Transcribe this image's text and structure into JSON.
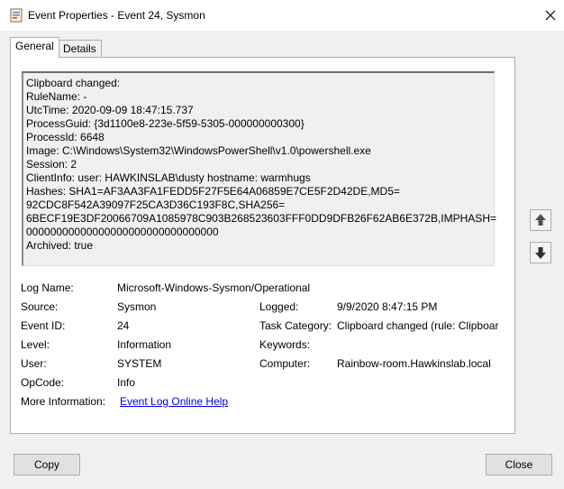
{
  "window": {
    "title": "Event Properties - Event 24, Sysmon"
  },
  "tabs": [
    {
      "label": "General",
      "active": true
    },
    {
      "label": "Details",
      "active": false
    }
  ],
  "description_lines": [
    "Clipboard changed:",
    "RuleName: -",
    "UtcTime: 2020-09-09 18:47:15.737",
    "ProcessGuid: {3d1100e8-223e-5f59-5305-000000000300}",
    "ProcessId: 6648",
    "Image: C:\\Windows\\System32\\WindowsPowerShell\\v1.0\\powershell.exe",
    "Session: 2",
    "ClientInfo: user: HAWKINSLAB\\dusty hostname: warmhugs",
    "Hashes: SHA1=AF3AA3FA1FEDD5F27F5E64A06859E7CE5F2D42DE,MD5=",
    "92CDC8F542A39097F25CA3D36C193F8C,SHA256=",
    "6BECF19E3DF20066709A1085978C903B268523603FFF0DD9DFB26F62AB6E372B,IMPHASH=",
    "00000000000000000000000000000000",
    "Archived: true"
  ],
  "fields": {
    "log_name": {
      "label": "Log Name:",
      "value": "Microsoft-Windows-Sysmon/Operational"
    },
    "source": {
      "label": "Source:",
      "value": "Sysmon"
    },
    "logged": {
      "label": "Logged:",
      "value": "9/9/2020 8:47:15 PM"
    },
    "event_id": {
      "label": "Event ID:",
      "value": "24"
    },
    "task_category": {
      "label": "Task Category:",
      "value": "Clipboard changed (rule: Clipboar"
    },
    "level": {
      "label": "Level:",
      "value": "Information"
    },
    "keywords": {
      "label": "Keywords:",
      "value": ""
    },
    "user": {
      "label": "User:",
      "value": "SYSTEM"
    },
    "computer": {
      "label": "Computer:",
      "value": "Rainbow-room.Hawkinslab.local"
    },
    "opcode": {
      "label": "OpCode:",
      "value": "Info"
    },
    "more_info": {
      "label": "More Information:",
      "value": "Event Log Online Help"
    }
  },
  "buttons": {
    "copy": "Copy",
    "close": "Close"
  },
  "icons": {
    "app": "event-viewer-icon",
    "close": "close-icon",
    "up": "arrow-up-icon",
    "down": "arrow-down-icon"
  },
  "colors": {
    "link": "#0000ee",
    "arrow_icon": "#505050"
  }
}
